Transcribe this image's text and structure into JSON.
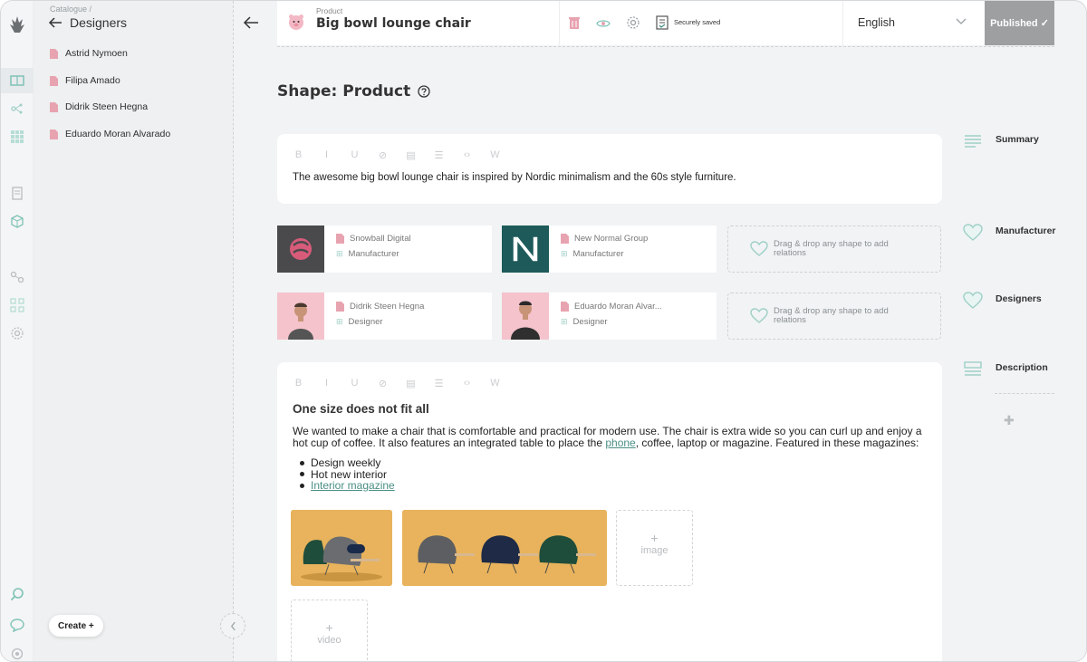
{
  "sidebar": {
    "breadcrumb": "Catalogue /",
    "folder_title": "Designers",
    "items": [
      {
        "label": "Astrid Nymoen"
      },
      {
        "label": "Filipa Amado"
      },
      {
        "label": "Didrik Steen Hegna"
      },
      {
        "label": "Eduardo Moran Alvarado"
      }
    ],
    "create_label": "Create +"
  },
  "header": {
    "item_type": "Product",
    "item_title": "Big bowl lounge chair",
    "save_status": "Securely saved",
    "language": "English",
    "publish_label": "Published ✓"
  },
  "shape": {
    "title": "Shape: Product"
  },
  "summary": {
    "text": "The awesome big bowl lounge chair is inspired by Nordic minimalism and the 60s style furniture."
  },
  "relations": {
    "manufacturers": [
      {
        "name": "Snowball Digital",
        "role": "Manufacturer"
      },
      {
        "name": "New Normal Group",
        "role": "Manufacturer"
      }
    ],
    "designers": [
      {
        "name": "Didrik Steen Hegna",
        "role": "Designer"
      },
      {
        "name": "Eduardo Moran Alvar...",
        "role": "Designer"
      }
    ],
    "drop_text": "Drag & drop any shape to add relations"
  },
  "description": {
    "heading": "One size does not fit all",
    "para_part1": "We wanted to make a chair that is comfortable and practical for modern use. The chair is extra wide so you can curl up and enjoy a hot cup of coffee. It also features an integrated table to place the ",
    "para_link": "phone",
    "para_part2": ", coffee, laptop or magazine. Featured in these magazines:",
    "bullets": [
      "Design weekly",
      "Hot new interior",
      "Interior magazine"
    ],
    "add_image": "image",
    "add_video": "video"
  },
  "component_index": [
    {
      "label": "Summary",
      "icon": "paragraph-icon"
    },
    {
      "label": "Manufacturer",
      "icon": "heart-icon"
    },
    {
      "label": "Designers",
      "icon": "heart-icon"
    },
    {
      "label": "Description",
      "icon": "rich-text-icon"
    }
  ],
  "colors": {
    "accent_teal": "#4b8f86",
    "published_bg": "#9d9fa1",
    "doc_pink": "#e8a3b0"
  }
}
